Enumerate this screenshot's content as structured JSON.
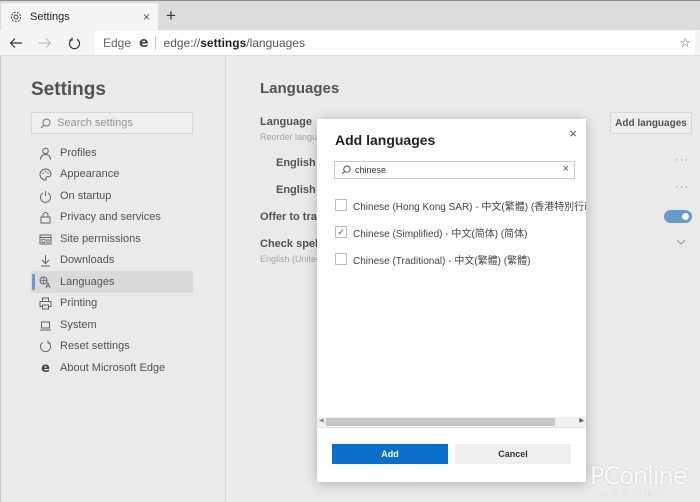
{
  "browser": {
    "tab_title": "Settings",
    "tab_close": "×",
    "new_tab": "+",
    "address_label": "Edge",
    "edge_glyph": "e",
    "url_prefix": "edge://",
    "url_bold": "settings",
    "url_suffix": "/languages",
    "favorite": "☆"
  },
  "sidebar": {
    "title": "Settings",
    "search_placeholder": "Search settings",
    "items": [
      {
        "label": "Profiles",
        "icon": "person-icon"
      },
      {
        "label": "Appearance",
        "icon": "palette-icon"
      },
      {
        "label": "On startup",
        "icon": "power-icon"
      },
      {
        "label": "Privacy and services",
        "icon": "lock-icon"
      },
      {
        "label": "Site permissions",
        "icon": "site-permissions-icon"
      },
      {
        "label": "Downloads",
        "icon": "download-icon"
      },
      {
        "label": "Languages",
        "icon": "languages-icon",
        "active": true
      },
      {
        "label": "Printing",
        "icon": "printer-icon"
      },
      {
        "label": "System",
        "icon": "laptop-icon"
      },
      {
        "label": "Reset settings",
        "icon": "reset-icon"
      },
      {
        "label": "About Microsoft Edge",
        "icon": "edge-logo-icon"
      }
    ]
  },
  "main": {
    "title": "Languages",
    "language_heading": "Language",
    "language_sub": "Reorder langu",
    "add_languages": "Add languages",
    "lang_row_1": "English (",
    "lang_row_2": "English",
    "more": "···",
    "offer_translate": "Offer to tran",
    "offer_translate_on": true,
    "spellcheck": "Check spelli",
    "spellcheck_sub": "English (Unitec"
  },
  "dialog": {
    "title": "Add languages",
    "close": "×",
    "search_value": "chinese",
    "clear": "×",
    "languages": [
      {
        "label": "Chinese (Hong Kong SAR) - 中文(繁體) (香港特別行政",
        "checked": false
      },
      {
        "label": "Chinese (Simplified) - 中文(简体) (简体)",
        "checked": true
      },
      {
        "label": "Chinese (Traditional) - 中文(繁體) (繁體)",
        "checked": false
      }
    ],
    "scroll_left": "◀",
    "scroll_right": "▶",
    "add_button": "Add",
    "cancel_button": "Cancel",
    "accent_color": "#0a6fc9"
  },
  "watermark": {
    "brand": "PConline",
    "sub": "太平洋电脑网"
  }
}
